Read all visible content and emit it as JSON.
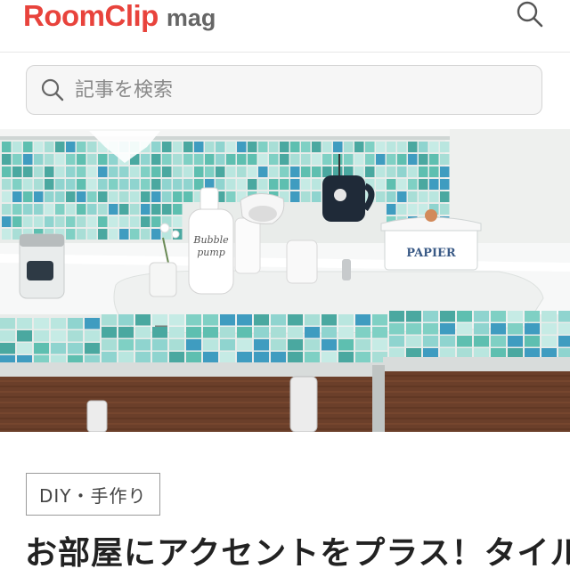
{
  "header": {
    "logo_main": "RoomClip",
    "logo_sub": "mag",
    "brand_color": "#e8433c",
    "logo_sub_color": "#666666",
    "search_icon": "search-icon"
  },
  "search": {
    "placeholder": "記事を検索",
    "icon": "search-icon"
  },
  "hero": {
    "image": "washbasin-with-mosaic-tiles",
    "bottle_text_1": "Bubble",
    "bottle_text_2": "pump",
    "canister_text": "PAPIER",
    "accent_color": "#5ebfb0"
  },
  "article": {
    "category": "DIY・手作り",
    "title": "お部屋にアクセントをプラス！タイル"
  }
}
